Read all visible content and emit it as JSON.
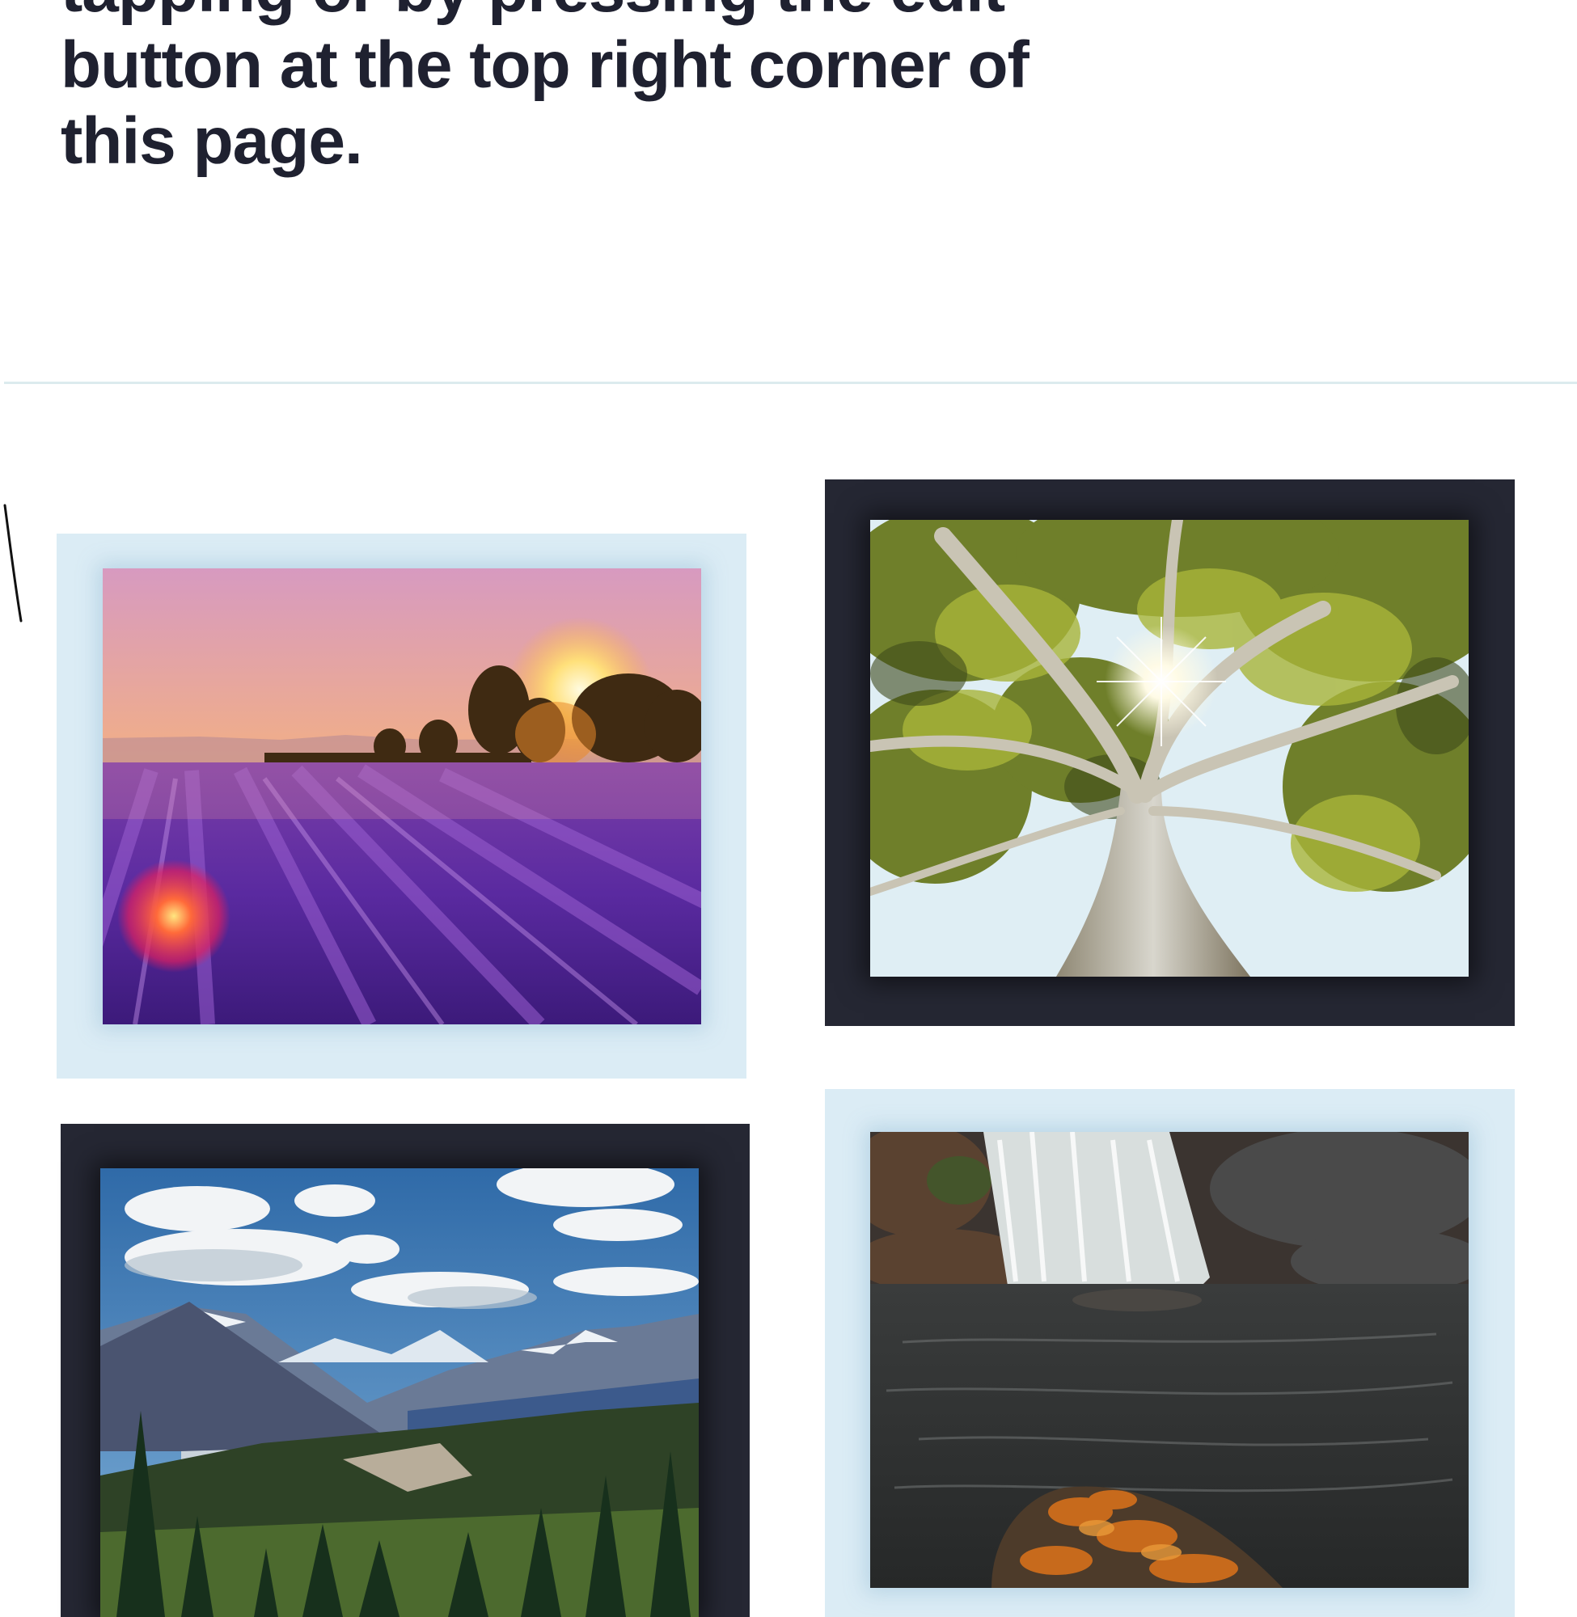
{
  "intro": {
    "lines": [
      "tapping or by pressing the edit",
      "button at the top right corner of",
      "this page."
    ]
  },
  "gallery": {
    "items": [
      {
        "subject": "lavender-field-sunset",
        "frame_style": "light"
      },
      {
        "subject": "sunlit-tree-canopy",
        "frame_style": "dark"
      },
      {
        "subject": "mountain-valley-forest",
        "frame_style": "dark"
      },
      {
        "subject": "forest-waterfall-pool",
        "frame_style": "light"
      }
    ]
  },
  "colors": {
    "heading_text": "#1f2130",
    "light_frame": "#dbecf5",
    "dark_frame": "#252733",
    "divider": "#dcebee"
  }
}
